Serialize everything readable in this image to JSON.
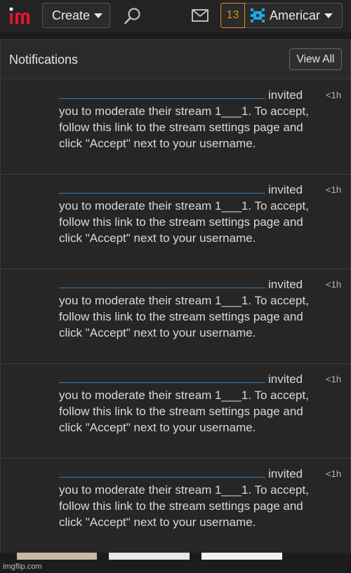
{
  "header": {
    "logo_text": "im",
    "create_label": "Create",
    "notification_count": "13",
    "username": "Americar"
  },
  "panel": {
    "title": "Notifications",
    "view_all_label": "View All"
  },
  "notifications": [
    {
      "verb": "invited",
      "body": "you to moderate their stream 1___1. To accept, follow this link to the stream settings page and click \"Accept\" next to your username.",
      "time": "<1h"
    },
    {
      "verb": "invited",
      "body": "you to moderate their stream 1___1. To accept, follow this link to the stream settings page and click \"Accept\" next to your username.",
      "time": "<1h"
    },
    {
      "verb": "invited",
      "body": "you to moderate their stream 1___1. To accept, follow this link to the stream settings page and click \"Accept\" next to your username.",
      "time": "<1h"
    },
    {
      "verb": "invited",
      "body": "you to moderate their stream 1___1. To accept, follow this link to the stream settings page and click \"Accept\" next to your username.",
      "time": "<1h"
    },
    {
      "verb": "invited",
      "body": "you to moderate their stream 1___1. To accept, follow this link to the stream settings page and click \"Accept\" next to your username.",
      "time": "<1h"
    }
  ],
  "footer": {
    "watermark": "imgflip.com"
  },
  "colors": {
    "accent_orange": "#e38a15",
    "link_blue": "#2e80b8",
    "logo_red": "#e8142a",
    "avatar_cyan": "#1fa9e0"
  }
}
